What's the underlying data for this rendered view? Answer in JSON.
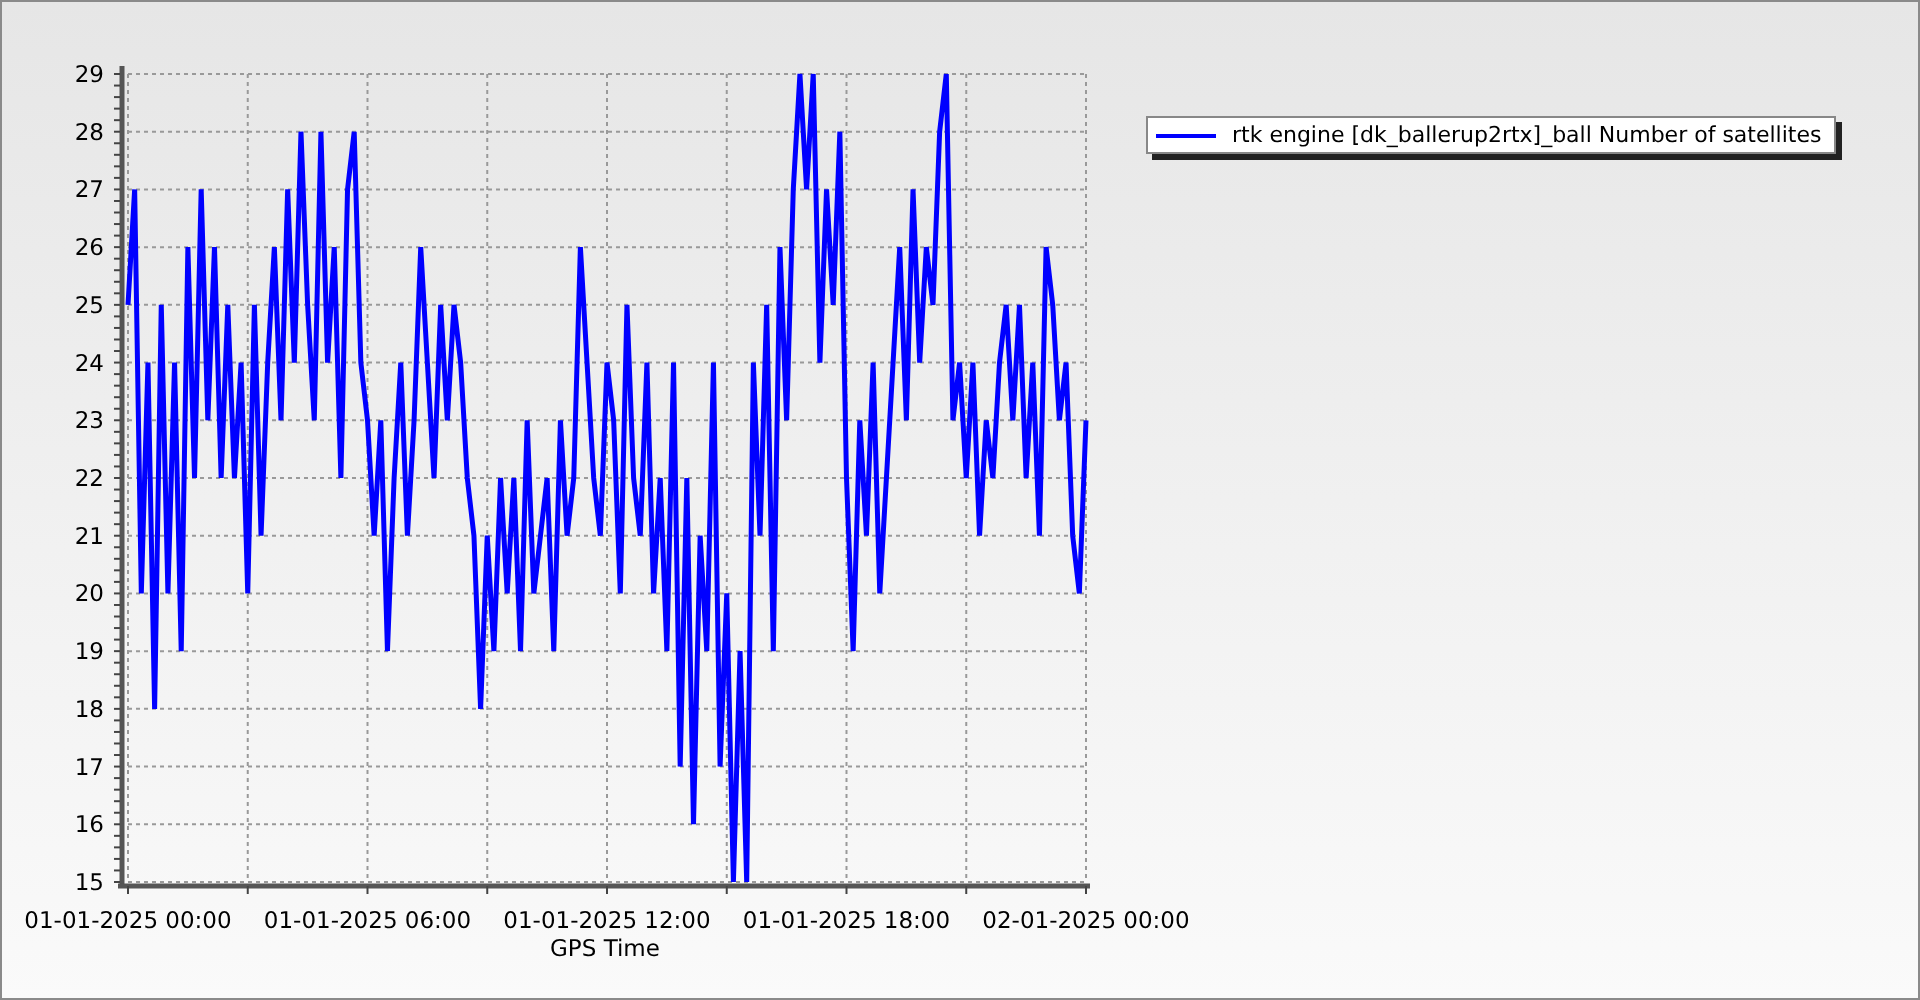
{
  "chart_data": {
    "type": "line",
    "xlabel": "GPS Time",
    "grid": true,
    "ylim": [
      15,
      29
    ],
    "yticks": [
      15,
      16,
      17,
      18,
      19,
      20,
      21,
      22,
      23,
      24,
      25,
      26,
      27,
      28,
      29
    ],
    "categories": [
      "01-01-2025 00:00",
      null,
      null,
      null,
      null,
      null,
      null,
      null,
      null,
      null,
      null,
      null,
      null,
      null,
      null,
      null,
      null,
      null,
      null,
      null,
      null,
      null,
      null,
      null,
      null,
      null,
      null,
      null,
      null,
      null,
      null,
      null,
      null,
      null,
      null,
      null,
      "01-01-2025 06:00",
      null,
      null,
      null,
      null,
      null,
      null,
      null,
      null,
      null,
      null,
      null,
      null,
      null,
      null,
      null,
      null,
      null,
      null,
      null,
      null,
      null,
      null,
      null,
      null,
      null,
      null,
      null,
      null,
      null,
      null,
      null,
      null,
      null,
      null,
      null,
      "01-01-2025 12:00",
      null,
      null,
      null,
      null,
      null,
      null,
      null,
      null,
      null,
      null,
      null,
      null,
      null,
      null,
      null,
      null,
      null,
      null,
      null,
      null,
      null,
      null,
      null,
      null,
      null,
      null,
      null,
      null,
      null,
      null,
      null,
      null,
      null,
      null,
      null,
      "01-01-2025 18:00",
      null,
      null,
      null,
      null,
      null,
      null,
      null,
      null,
      null,
      null,
      null,
      null,
      null,
      null,
      null,
      null,
      null,
      null,
      null,
      null,
      null,
      null,
      null,
      null,
      null,
      null,
      null,
      null,
      null,
      null,
      null,
      null,
      null,
      null,
      null,
      "02-01-2025 00:00"
    ],
    "series": [
      {
        "name": "rtk engine [dk_ballerup2rtx]_ball Number of satellites",
        "color": "#0000ff",
        "values": [
          25,
          27,
          20,
          24,
          18,
          25,
          20,
          24,
          19,
          26,
          22,
          27,
          23,
          26,
          22,
          25,
          22,
          24,
          20,
          25,
          21,
          24,
          26,
          23,
          27,
          24,
          28,
          25,
          23,
          28,
          24,
          26,
          22,
          27,
          28,
          24,
          23,
          21,
          23,
          19,
          22,
          24,
          21,
          23,
          26,
          24,
          22,
          25,
          23,
          25,
          24,
          22,
          21,
          18,
          21,
          19,
          22,
          20,
          22,
          19,
          23,
          20,
          21,
          22,
          19,
          23,
          21,
          22,
          26,
          24,
          22,
          21,
          24,
          23,
          20,
          25,
          22,
          21,
          24,
          20,
          22,
          19,
          24,
          17,
          22,
          16,
          21,
          19,
          24,
          17,
          20,
          15,
          19,
          15,
          24,
          21,
          25,
          19,
          26,
          23,
          27,
          29,
          27,
          29,
          24,
          27,
          25,
          28,
          22,
          19,
          23,
          21,
          24,
          20,
          22,
          24,
          26,
          23,
          27,
          24,
          26,
          25,
          28,
          29,
          23,
          24,
          22,
          24,
          21,
          23,
          22,
          24,
          25,
          23,
          25,
          22,
          24,
          21,
          26,
          25,
          23,
          24,
          21,
          20,
          23
        ]
      }
    ]
  }
}
